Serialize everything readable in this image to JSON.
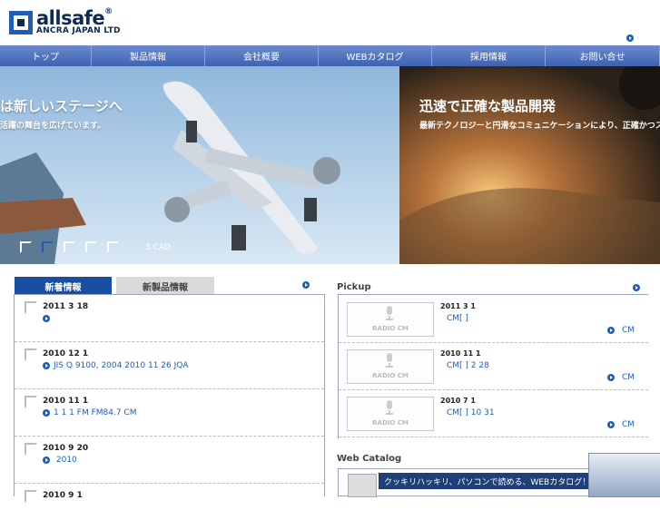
{
  "header": {
    "logo": {
      "name": "allsafe",
      "registered": "®",
      "subtitle": "ANCRA JAPAN LTD"
    },
    "corner_arrow": "arrow-icon"
  },
  "nav": {
    "items": [
      {
        "label": "トップ"
      },
      {
        "label": "製品情報"
      },
      {
        "label": "会社概要"
      },
      {
        "label": "WEBカタログ"
      },
      {
        "label": "採用情報"
      },
      {
        "label": "お問い合せ"
      }
    ]
  },
  "hero": {
    "left": {
      "title": "は新しいステージへ",
      "subtitle": "活躍の舞台を広げています。"
    },
    "right": {
      "title": "迅速で正確な製品開発",
      "subtitle": "最新テクノロジーと円滑なコミュニケーションにより、正確かつスピ"
    },
    "cad_label": "3 CAD",
    "thumb_count": 5,
    "active_thumb": 2
  },
  "news": {
    "tabs": [
      {
        "label": "新着情報"
      },
      {
        "label": "新製品情報"
      }
    ],
    "items": [
      {
        "date": "2011  3  18",
        "text": ""
      },
      {
        "date": "2010  12  1",
        "text": "JIS Q 9100, 2004                  2010 11 26          JQA"
      },
      {
        "date": "2010  11  1",
        "text": "1 1  1   FM   FM84.7            CM"
      },
      {
        "date": "2010  9  20",
        "text": "        2010"
      },
      {
        "date": "2010  9  1",
        "text": ""
      }
    ]
  },
  "pickup": {
    "title": "Pickup",
    "items": [
      {
        "date": "2011  3  1",
        "text": "CM[    ]",
        "cm": "CM",
        "badge": "RADIO CM"
      },
      {
        "date": "2010  11  1",
        "text": "CM[    ]      2 28",
        "cm": "CM",
        "badge": "RADIO CM"
      },
      {
        "date": "2010  7  1",
        "text": "CM[    ]          10 31",
        "cm": "CM",
        "badge": "RADIO CM"
      }
    ]
  },
  "catalog": {
    "title": "Web Catalog",
    "banner_text": "クッキリハッキリ、パソコンで読める、WEBカタログ！"
  },
  "colors": {
    "nav": "#3d62b1",
    "accent": "#1d5fb7",
    "tab_active": "#1a4ea2"
  }
}
